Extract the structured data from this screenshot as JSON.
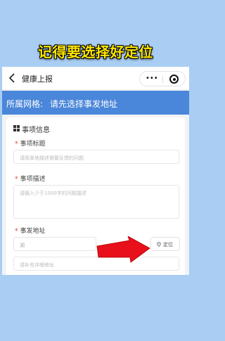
{
  "overlay": {
    "caption": "记得要选择好定位"
  },
  "navbar": {
    "title": "健康上报",
    "more": "•••"
  },
  "header": {
    "grid_label": "所属网格:",
    "grid_value": "请先选择事发地址"
  },
  "section": {
    "title": "事项信息"
  },
  "fields": {
    "title": {
      "required": "*",
      "label": "事项标题",
      "placeholder": "请简单地描述需要反馈的问题"
    },
    "description": {
      "required": "*",
      "label": "事项描述",
      "placeholder": "请输入少于1000字的问题描述"
    },
    "address": {
      "required": "*",
      "label": "事发地址",
      "value": "湖",
      "locate_label": "定位",
      "detail_placeholder": "请补充详细地址"
    }
  },
  "colors": {
    "accent": "#4a86d9",
    "background": "#a9cdf3",
    "caption": "#ffe600",
    "arrow": "#e8101a"
  }
}
